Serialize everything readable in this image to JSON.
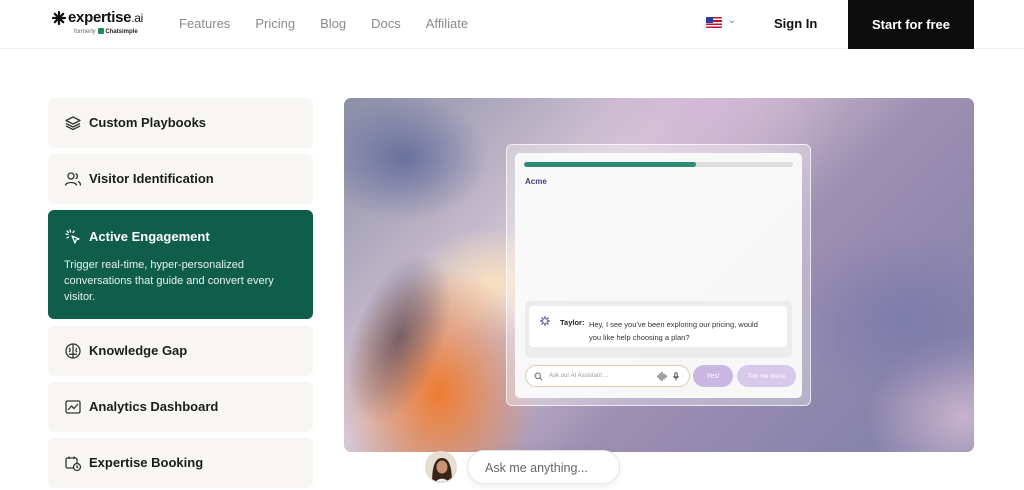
{
  "header": {
    "logo_name": "expertise",
    "logo_suffix": ".ai",
    "logo_formerly": "formerly",
    "logo_formerly_brand": "Chatsimple",
    "nav": [
      "Features",
      "Pricing",
      "Blog",
      "Docs",
      "Affiliate"
    ],
    "language_icon": "us-flag-icon",
    "sign_in": "Sign In",
    "cta": "Start for free"
  },
  "features": [
    {
      "label": "Custom Playbooks",
      "icon": "layers-icon",
      "active": false
    },
    {
      "label": "Visitor Identification",
      "icon": "users-icon",
      "active": false
    },
    {
      "label": "Active Engagement",
      "icon": "cursor-click-icon",
      "active": true,
      "description": "Trigger real-time, hyper-personalized conversations that guide and convert every visitor."
    },
    {
      "label": "Knowledge Gap",
      "icon": "brain-icon",
      "active": false
    },
    {
      "label": "Analytics Dashboard",
      "icon": "chart-icon",
      "active": false
    },
    {
      "label": "Expertise Booking",
      "icon": "calendar-clock-icon",
      "active": false
    }
  ],
  "demo": {
    "progress": 0.64,
    "brand": "Acme",
    "message_sender": "Taylor:",
    "message_text": "Hey, I see you've been exploring our pricing, would you like help choosing a plan?",
    "input_placeholder": "Ask our AI Assistant ...",
    "reply_yes": "Yes!",
    "reply_more": "Tell me more"
  },
  "ask_bar": {
    "placeholder": "Ask me anything..."
  },
  "colors": {
    "active_feature_bg": "#0f5e4a",
    "progress_fill": "#2d8c78",
    "cta_bg": "#0d0d0d"
  }
}
